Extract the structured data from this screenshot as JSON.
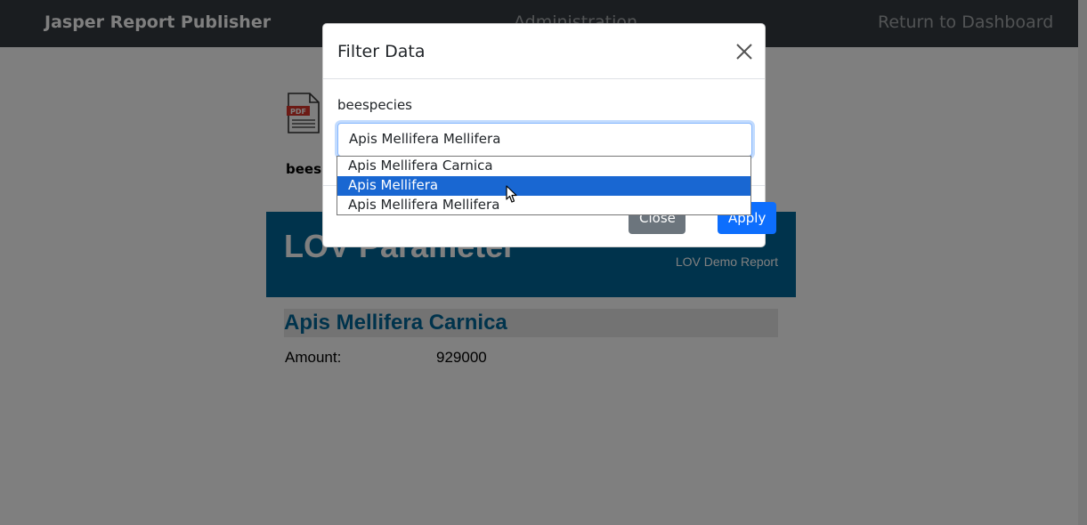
{
  "navbar": {
    "brand": "Jasper Report Publisher",
    "admin": "Administration",
    "return": "Return to Dashboard"
  },
  "report_item": {
    "icon": "pdf-file-icon",
    "icon_text": "PDF",
    "name": "beesp"
  },
  "report": {
    "title": "LOV Parameter",
    "subtitle": "LOV Demo Report",
    "group_title": "Apis Mellifera Carnica",
    "amount_label": "Amount:",
    "amount_value": "929000"
  },
  "modal": {
    "title": "Filter Data",
    "close_icon": "close-icon",
    "field_label": "beespecies",
    "selected_value": "Apis Mellifera Mellifera",
    "options": [
      "Apis Mellifera Carnica",
      "Apis Mellifera",
      "Apis Mellifera Mellifera"
    ],
    "highlighted_option": "Apis Mellifera",
    "close_label": "Close",
    "apply_label": "Apply"
  },
  "colors": {
    "navbar": "#343a40",
    "report_header": "#006699",
    "primary": "#0d6efd",
    "secondary": "#6c757d",
    "option_highlight": "#1967d2"
  }
}
